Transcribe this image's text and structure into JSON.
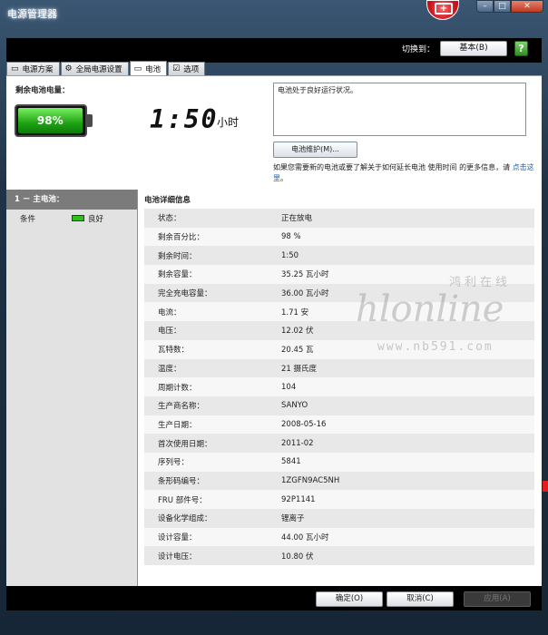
{
  "window": {
    "title": "电源管理器"
  },
  "header": {
    "switch_label": "切换到：",
    "mode_button": "基本(B)",
    "help": "?"
  },
  "tabs": [
    {
      "label": "电源方案",
      "icon": "battery-outline-icon"
    },
    {
      "label": "全局电源设置",
      "icon": "gear-icon"
    },
    {
      "label": "电池",
      "icon": "battery-icon"
    },
    {
      "label": "选项",
      "icon": "checkbox-icon"
    }
  ],
  "battery": {
    "remaining_label": "剩余电池电量：",
    "percent_text": "98%",
    "charge_level": 0.98,
    "time": "1:50",
    "time_unit": "小时",
    "status_message": "电池处于良好运行状况。",
    "maintenance_button": "电池维护(M)...",
    "info_text": "如果您需要新的电池或要了解关于如何延长电池 使用时间 的更多信息，请 ",
    "info_link": "点击这里",
    "info_tail": "。"
  },
  "left_panel": {
    "heading": "1 － 主电池：",
    "condition_label": "条件",
    "condition_value": "良好"
  },
  "details": {
    "title": "电池详细信息",
    "rows": [
      {
        "k": "状态：",
        "v": "正在放电"
      },
      {
        "k": "剩余百分比：",
        "v": "98 %"
      },
      {
        "k": "剩余时间：",
        "v": "1:50"
      },
      {
        "k": "剩余容量：",
        "v": "35.25 瓦小时"
      },
      {
        "k": "完全充电容量：",
        "v": "36.00 瓦小时"
      },
      {
        "k": "电流：",
        "v": "1.71 安"
      },
      {
        "k": "电压：",
        "v": "12.02 伏"
      },
      {
        "k": "瓦特数：",
        "v": "20.45 瓦"
      },
      {
        "k": "温度：",
        "v": "21 摄氏度"
      },
      {
        "k": "周期计数：",
        "v": "104"
      },
      {
        "k": "生产商名称：",
        "v": "SANYO"
      },
      {
        "k": "生产日期：",
        "v": "2008-05-16"
      },
      {
        "k": "首次使用日期：",
        "v": "2011-02"
      },
      {
        "k": "序列号：",
        "v": "5841"
      },
      {
        "k": "条形码编号：",
        "v": "1ZGFN9AC5NH"
      },
      {
        "k": "FRU 部件号：",
        "v": "92P1141"
      },
      {
        "k": "设备化学组成：",
        "v": "锂离子"
      },
      {
        "k": "设计容量：",
        "v": "44.00 瓦小时"
      },
      {
        "k": "设计电压：",
        "v": "10.80 伏"
      }
    ]
  },
  "footer": {
    "ok": "确定(O)",
    "cancel": "取消(C)",
    "apply": "应用(A)"
  },
  "watermark": {
    "script": "hlonline",
    "cn": "鸿利在线",
    "url": "www.nb591.com"
  },
  "colors": {
    "battery_green": "#1ea313",
    "link": "#1b5fb3",
    "chrome": "#1f3346"
  }
}
